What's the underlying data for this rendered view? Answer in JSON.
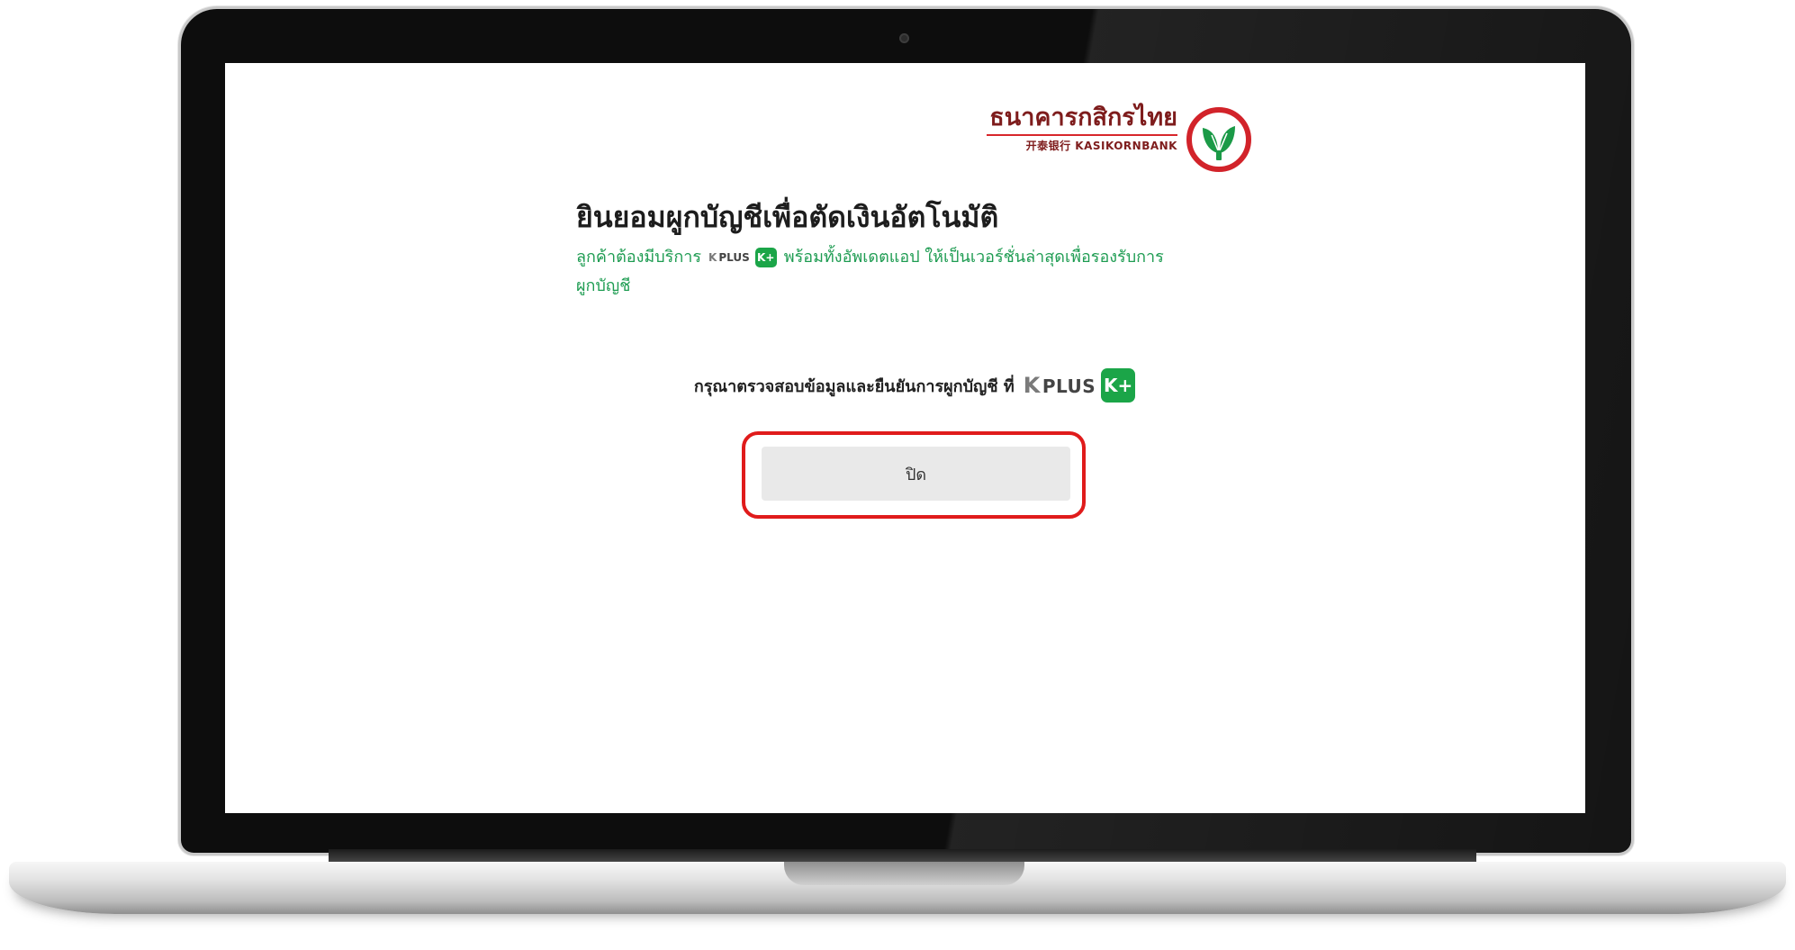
{
  "bank_logo": {
    "name_th": "ธนาคารกสิกรไทย",
    "name_en": "开泰银行 KASIKORNBANK",
    "icon": "kasikornbank-leaf-logo"
  },
  "heading": "ยินยอมผูกบัญชีเพื่อตัดเงินอัตโนมัติ",
  "notice": {
    "before": "ลูกค้าต้องมีบริการ",
    "after": "พร้อมทั้งอัพเดตแอป ให้เป็นเวอร์ชั่นล่าสุดเพื่อรองรับการ",
    "line2": "ผูกบัญชี"
  },
  "kplus": {
    "k": "K",
    "plus": "PLUS",
    "badge": "K+"
  },
  "confirm_message": "กรุณาตรวจสอบข้อมูลและยืนยันการผูกบัญชี ที่",
  "close_button": {
    "label": "ปิด"
  },
  "colors": {
    "accent_green": "#1ba548",
    "notice_green": "#1e9c52",
    "highlight_red": "#e01b1b",
    "brand_red": "#7e1c1c",
    "button_gray": "#e9e9e9"
  }
}
